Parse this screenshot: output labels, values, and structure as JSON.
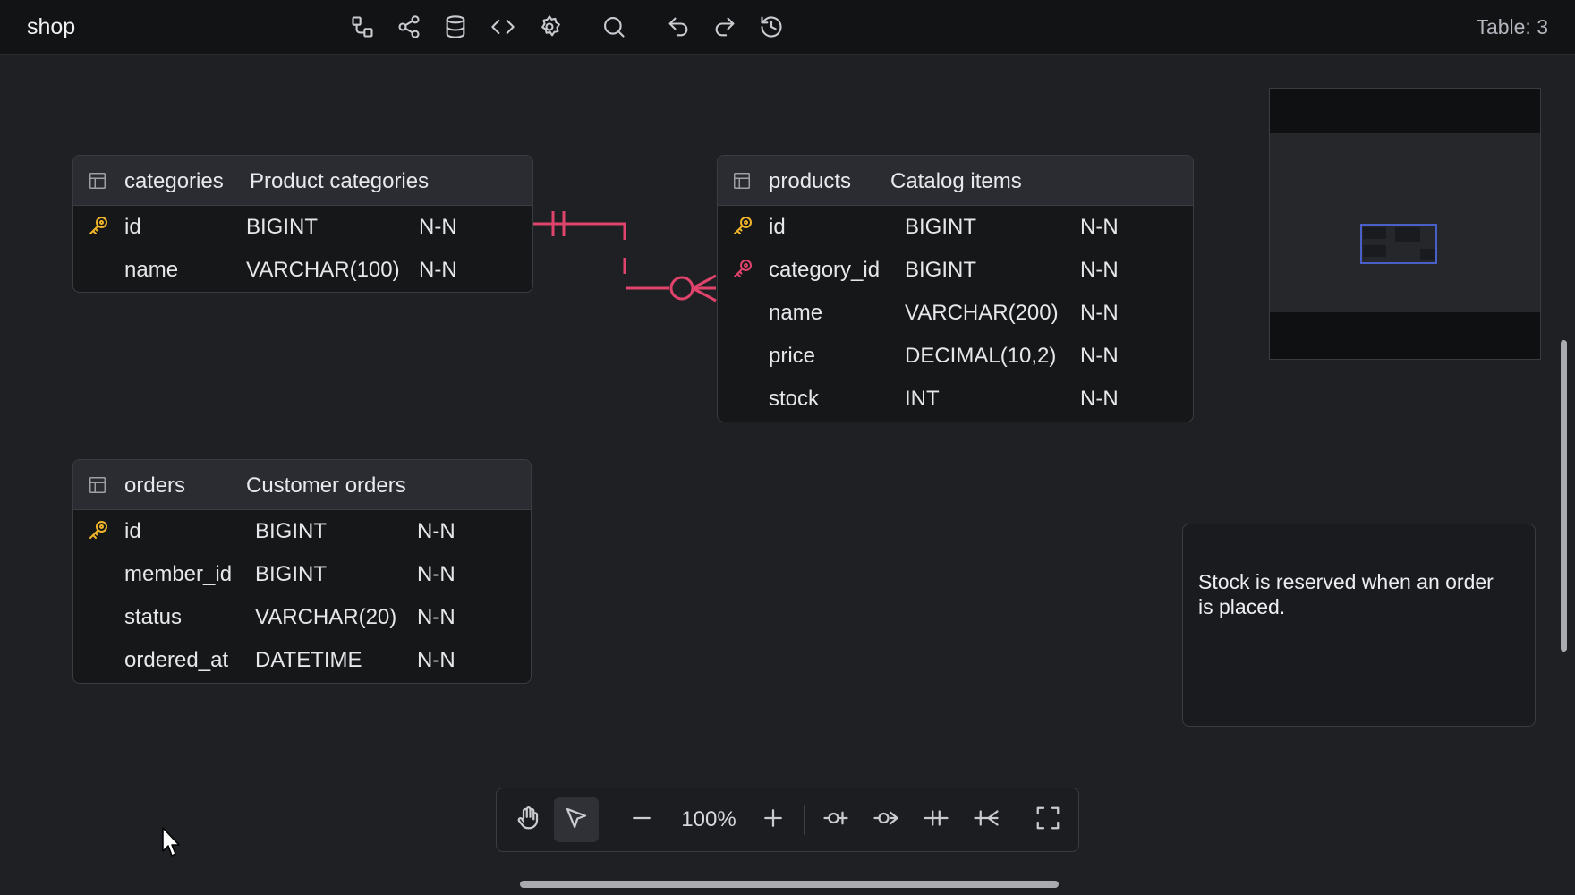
{
  "app": {
    "title": "shop",
    "table_count": "Table: 3"
  },
  "toolbar": {
    "icons": [
      "relations-icon",
      "share-icon",
      "database-icon",
      "code-icon",
      "settings-icon",
      "search-icon",
      "undo-icon",
      "redo-icon",
      "history-icon"
    ]
  },
  "tables": {
    "categories": {
      "name": "categories",
      "comment": "Product categories",
      "columns": [
        {
          "name": "id",
          "type": "BIGINT",
          "nullable": "N-N",
          "key": "primary"
        },
        {
          "name": "name",
          "type": "VARCHAR(100)",
          "nullable": "N-N",
          "key": ""
        }
      ]
    },
    "products": {
      "name": "products",
      "comment": "Catalog items",
      "columns": [
        {
          "name": "id",
          "type": "BIGINT",
          "nullable": "N-N",
          "key": "primary"
        },
        {
          "name": "category_id",
          "type": "BIGINT",
          "nullable": "N-N",
          "key": "foreign"
        },
        {
          "name": "name",
          "type": "VARCHAR(200)",
          "nullable": "N-N",
          "key": ""
        },
        {
          "name": "price",
          "type": "DECIMAL(10,2)",
          "nullable": "N-N",
          "key": ""
        },
        {
          "name": "stock",
          "type": "INT",
          "nullable": "N-N",
          "key": ""
        }
      ]
    },
    "orders": {
      "name": "orders",
      "comment": "Customer orders",
      "columns": [
        {
          "name": "id",
          "type": "BIGINT",
          "nullable": "N-N",
          "key": "primary"
        },
        {
          "name": "member_id",
          "type": "BIGINT",
          "nullable": "N-N",
          "key": ""
        },
        {
          "name": "status",
          "type": "VARCHAR(20)",
          "nullable": "N-N",
          "key": ""
        },
        {
          "name": "ordered_at",
          "type": "DATETIME",
          "nullable": "N-N",
          "key": ""
        }
      ]
    }
  },
  "relationship": {
    "from": "categories.id",
    "to": "products.category_id",
    "type": "one-to-zero-or-many",
    "color": "#e0436b"
  },
  "memo": {
    "text": "Stock is reserved when an order is placed."
  },
  "bottom_toolbar": {
    "zoom": "100%",
    "tools": [
      "hand-icon",
      "pointer-icon",
      "zoom-out-icon",
      "zoom-in-icon",
      "zero-one-icon",
      "zero-many-icon",
      "one-only-icon",
      "one-many-icon",
      "fullscreen-icon"
    ],
    "active_tool": "pointer"
  },
  "colors": {
    "primary_key": "#f0b429",
    "foreign_key": "#e0436b",
    "minimap_viewport": "#4a60c9"
  }
}
